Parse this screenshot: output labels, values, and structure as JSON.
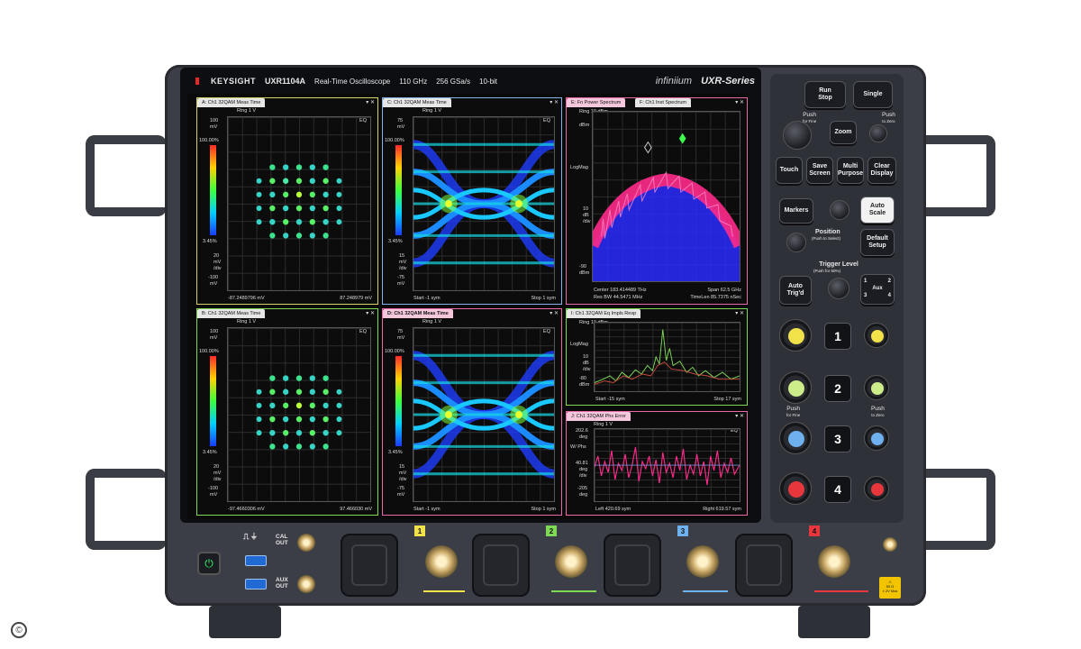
{
  "header": {
    "brand": "KEYSIGHT",
    "model": "UXR1104A",
    "description": "Real-Time Oscilloscope",
    "bandwidth": "110 GHz",
    "sample_rate": "256 GSa/s",
    "bits": "10-bit",
    "product_line": "infiniium",
    "series": "UXR-Series"
  },
  "windows": {
    "a": {
      "tab": "A: Ch1 32QAM Meas Time",
      "ring": "Ring 1  V",
      "eq": "EQ",
      "y_top": "100",
      "y_unit": "mV",
      "pct_top": "100.00%",
      "pct_bottom": "3.45%",
      "y_lower1": "20",
      "y_lower_unit": "mV",
      "y_div": "/div",
      "y_bottom": "-100",
      "y_bottom_unit": "mV",
      "x_left": "-87.2489796 mV",
      "x_right": "87.248979 mV"
    },
    "c": {
      "tab": "C: Ch1 32QAM Meas Time",
      "ring": "Ring 1  V",
      "eq": "EQ",
      "y_top": "75",
      "y_unit": "mV",
      "pct_top": "100.00%",
      "pct_bottom": "3.45%",
      "y_lower1": "15",
      "y_lower_unit": "mV",
      "y_div": "/div",
      "y_bottom": "-75",
      "y_bottom_unit": "mV",
      "x_left": "Start -1  sym",
      "x_right": "Stop 1  sym"
    },
    "e": {
      "tab": "E: Fn Power Spectrum",
      "tab2": "F: Ch1 Inst Spectrum",
      "ring": "Ring 10 dBm",
      "y_top_unit": "dBm",
      "logmag": "LogMag",
      "y_mid": "10",
      "y_mid_unit": "dB",
      "y_div": "/div",
      "y_bottom": "-90",
      "y_bottom_unit": "dBm",
      "center": "Center 183.414489 THz",
      "span": "Span 62.5 GHz",
      "rbw": "Res BW 44.5471 MHz",
      "timelen": "TimeLen 85.7375 nSec"
    },
    "b": {
      "tab": "B: Ch1 32QAM Meas Time",
      "ring": "Ring 1  V",
      "eq": "EQ",
      "y_top": "100",
      "y_unit": "mV",
      "pct_top": "100.00%",
      "pct_bottom": "3.45%",
      "y_lower1": "20",
      "y_lower_unit": "mV",
      "y_div": "/div",
      "y_bottom": "-100",
      "y_bottom_unit": "mV",
      "x_left": "-97.4660306 mV",
      "x_right": "97.466030 mV"
    },
    "d": {
      "tab": "D: Ch1 32QAM Meas Time",
      "ring": "Ring 1  V",
      "eq": "EQ",
      "y_top": "75",
      "y_unit": "mV",
      "pct_top": "100.00%",
      "pct_bottom": "3.45%",
      "y_lower1": "15",
      "y_lower_unit": "mV",
      "y_div": "/div",
      "y_bottom": "-75",
      "y_bottom_unit": "mV",
      "x_left": "Start -1  sym",
      "x_right": "Stop 1  sym"
    },
    "i": {
      "tab": "I: Ch1 32QAM Eq Impls Resp",
      "ring": "Ring 10 dBm",
      "logmag": "LogMag",
      "y_mid": "10",
      "y_mid_unit": "dB",
      "y_div": "/div",
      "y_bottom": "-80",
      "y_bottom_unit": "dBm",
      "x_left": "Start -15  sym",
      "x_right": "Stop 17  sym"
    },
    "j": {
      "tab": "J: Ch1 32QAM Phs Error",
      "ring": "Ring 1  V",
      "eq": "EQ",
      "y_top": "202.6",
      "y_unit": "deg",
      "w_phs": "W/ Phs",
      "y_mid": "40.81",
      "y_mid_unit": "deg",
      "y_div": "/div",
      "y_bottom": "-205",
      "y_bottom_unit": "deg",
      "x_left": "Left 420.69  sym",
      "x_right": "Right 619.57  sym"
    }
  },
  "panel": {
    "run_stop_l1": "Run",
    "run_stop_l2": "Stop",
    "single": "Single",
    "push_for_fine_l1": "Push",
    "push_for_fine_l2": "for Fine",
    "push_to_zero_l1": "Push",
    "push_to_zero_l2": "to Zero",
    "zoom": "Zoom",
    "touch": "Touch",
    "save_screen_l1": "Save",
    "save_screen_l2": "Screen",
    "multi_purpose_l1": "Multi",
    "multi_purpose_l2": "Purpose",
    "clear_display_l1": "Clear",
    "clear_display_l2": "Display",
    "markers": "Markers",
    "auto_scale_l1": "Auto",
    "auto_scale_l2": "Scale",
    "position": "Position",
    "position_sub": "(Push to Select)",
    "default_setup_l1": "Default",
    "default_setup_l2": "Setup",
    "trigger_level": "Trigger Level",
    "trigger_sub": "(Push for 50%)",
    "auto_trigd_l1": "Auto",
    "auto_trigd_l2": "Trig'd",
    "aux_1": "1",
    "aux_2": "2",
    "aux_label": "Aux",
    "aux_3": "3",
    "aux_4": "4",
    "ch1": "1",
    "ch2": "2",
    "ch3": "3",
    "ch4": "4",
    "push_fine_ch_l1": "Push",
    "push_fine_ch_l2": "for Fine",
    "push_zero_ch_l1": "Push",
    "push_zero_ch_l2": "to Zero"
  },
  "front": {
    "cal_out_l1": "CAL",
    "cal_out_l2": "OUT",
    "aux_out_l1": "AUX",
    "aux_out_l2": "OUT",
    "ch_tags": [
      "1",
      "2",
      "3",
      "4"
    ],
    "warn_l1": "50 Ω",
    "warn_l2": "± 2V Max",
    "copyright": "©"
  },
  "colors": {
    "ch1": "#f2e24a",
    "ch2": "#7ed957",
    "ch3": "#6fb1ef",
    "ch4": "#e8373c",
    "accent_red": "#e8262e"
  }
}
